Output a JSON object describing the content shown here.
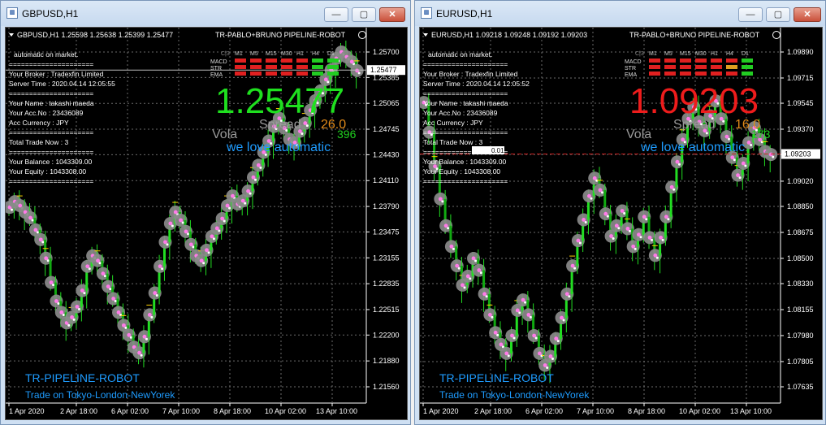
{
  "windows": [
    {
      "title": "GBPUSD,H1",
      "header": {
        "symbol_line": "GBPUSD,H1  1.25598 1.25638 1.25399 1.25477",
        "robot": "TR-PABLO+BRUNO PIPELINE-ROBOT"
      },
      "info_lines": [
        "automatic on market.",
        "=====================",
        "Your Broker  : Tradexfin Limited",
        "Server Time : 2020.04.14 12:05:55",
        "=====================",
        "Your Name   : takashi maeda",
        "Your Acc.No  : 23436089",
        "Acc Currency  : JPY",
        "=====================",
        "Total Trade Now : 3",
        "=====================",
        "Your Balance : 1043309.00",
        "Your Equity   : 1043308.00",
        "====================="
      ],
      "big_price": "1.25477",
      "big_price_color": "#1fe01f",
      "spread_label": "Spread",
      "spread_value": "26.0",
      "vola_label": "Vola",
      "vola_value": "396",
      "slogan": "we love automatic",
      "bottom_title": "TR-PIPELINE-ROBOT",
      "bottom_sub": "Trade on Tokyo-London-NewYorek",
      "current_price_tag": "1.25477",
      "y_labels": [
        "1.25700",
        "1.25385",
        "1.25065",
        "1.24745",
        "1.24430",
        "1.24110",
        "1.23790",
        "1.23475",
        "1.23155",
        "1.22835",
        "1.22515",
        "1.22200",
        "1.21880",
        "1.21560"
      ],
      "x_labels": [
        "1 Apr 2020",
        "2 Apr 18:00",
        "6 Apr 02:00",
        "7 Apr 10:00",
        "8 Apr 18:00",
        "10 Apr 02:00",
        "13 Apr 10:00"
      ],
      "panel": {
        "timeframes": [
          "M1",
          "M5",
          "M15",
          "M30",
          "H1",
          "H4",
          "D1"
        ],
        "rows": [
          "MACD",
          "STR",
          "EMA"
        ],
        "colors": [
          [
            "#e02020",
            "#e02020",
            "#e02020",
            "#e02020",
            "#e02020",
            "#22cc22",
            "#22cc22"
          ],
          [
            "#e02020",
            "#e02020",
            "#e02020",
            "#e02020",
            "#e02020",
            "#22cc22",
            "#22cc22"
          ],
          [
            "#e02020",
            "#e02020",
            "#e02020",
            "#e02020",
            "#e02020",
            "#22cc22",
            "#22cc22"
          ]
        ]
      },
      "candle_closes": [
        1.2378,
        1.2385,
        1.238,
        1.2372,
        1.2365,
        1.235,
        1.2338,
        1.2315,
        1.2285,
        1.2262,
        1.2248,
        1.2235,
        1.2242,
        1.2255,
        1.2275,
        1.2305,
        1.2318,
        1.2312,
        1.2296,
        1.228,
        1.2265,
        1.2248,
        1.2232,
        1.222,
        1.2205,
        1.2198,
        1.2218,
        1.2245,
        1.2272,
        1.2305,
        1.2335,
        1.2358,
        1.2372,
        1.2362,
        1.2348,
        1.2332,
        1.2318,
        1.2312,
        1.2325,
        1.2342,
        1.2352,
        1.2364,
        1.238,
        1.2392,
        1.2382,
        1.2386,
        1.2398,
        1.2415,
        1.243,
        1.2446,
        1.246,
        1.2478,
        1.2488,
        1.2476,
        1.2462,
        1.2458,
        1.2472,
        1.2482,
        1.2498,
        1.251,
        1.2522,
        1.2536,
        1.2548,
        1.2562,
        1.257,
        1.2564,
        1.2558,
        1.2547
      ]
    },
    {
      "title": "EURUSD,H1",
      "header": {
        "symbol_line": "EURUSD,H1  1.09218 1.09248 1.09192 1.09203",
        "robot": "TR-PABLO+BRUNO PIPELINE-ROBOT"
      },
      "info_lines": [
        "automatic on market.",
        "=====================",
        "Your Broker  : Tradexfin Limited",
        "Server Time : 2020.04.14 12:05:52",
        "=====================",
        "Your Name   : takashi maeda",
        "Your Acc.No  : 23436089",
        "Acc Currency  : JPY",
        "=====================",
        "Total Trade Now : 3",
        "=====================",
        "Your Balance : 1043309.00",
        "Your Equity   : 1043308.00",
        "====================="
      ],
      "big_price": "1.09203",
      "big_price_color": "#ee1c1c",
      "spread_label": "Spread",
      "spread_value": "16.0",
      "vola_label": "Vola",
      "vola_value": "173",
      "slogan": "we love automatic",
      "bottom_title": "TR-PIPELINE-ROBOT",
      "bottom_sub": "Trade on Tokyo-London-NewYorek",
      "current_price_tag": "1.09203",
      "lot_label": "0.01",
      "y_labels": [
        "1.09890",
        "1.09715",
        "1.09545",
        "1.09370",
        "1.09200",
        "1.09020",
        "1.08850",
        "1.08675",
        "1.08500",
        "1.08330",
        "1.08155",
        "1.07980",
        "1.07805",
        "1.07635"
      ],
      "x_labels": [
        "1 Apr 2020",
        "2 Apr 18:00",
        "6 Apr 02:00",
        "7 Apr 10:00",
        "8 Apr 18:00",
        "10 Apr 02:00",
        "13 Apr 10:00"
      ],
      "panel": {
        "timeframes": [
          "M1",
          "M5",
          "M15",
          "M30",
          "H1",
          "H4",
          "D1"
        ],
        "rows": [
          "MACD",
          "STR",
          "EMA"
        ],
        "colors": [
          [
            "#e02020",
            "#e02020",
            "#e02020",
            "#e02020",
            "#e02020",
            "#e02020",
            "#22cc22"
          ],
          [
            "#e02020",
            "#e02020",
            "#e02020",
            "#e02020",
            "#e02020",
            "#e0a020",
            "#22cc22"
          ],
          [
            "#e02020",
            "#e02020",
            "#e02020",
            "#e02020",
            "#e02020",
            "#e02020",
            "#22cc22"
          ]
        ]
      },
      "candle_closes": [
        1.0955,
        1.0935,
        1.0912,
        1.089,
        1.0872,
        1.0858,
        1.0845,
        1.0832,
        1.0838,
        1.085,
        1.0842,
        1.0826,
        1.0812,
        1.08,
        1.0792,
        1.0786,
        1.0798,
        1.0815,
        1.0822,
        1.0812,
        1.0798,
        1.0786,
        1.0778,
        1.0784,
        1.0796,
        1.081,
        1.0826,
        1.0845,
        1.0862,
        1.0876,
        1.0892,
        1.0904,
        1.0896,
        1.088,
        1.0865,
        1.0872,
        1.0882,
        1.087,
        1.0858,
        1.0866,
        1.0878,
        1.0864,
        1.0852,
        1.0864,
        1.0878,
        1.0898,
        1.0915,
        1.093,
        1.0944,
        1.0952,
        1.0942,
        1.0936,
        1.0946,
        1.0956,
        1.0944,
        1.0932,
        1.0918,
        1.0906,
        1.0914,
        1.0928,
        1.0938,
        1.093,
        1.0922,
        1.092
      ]
    }
  ]
}
